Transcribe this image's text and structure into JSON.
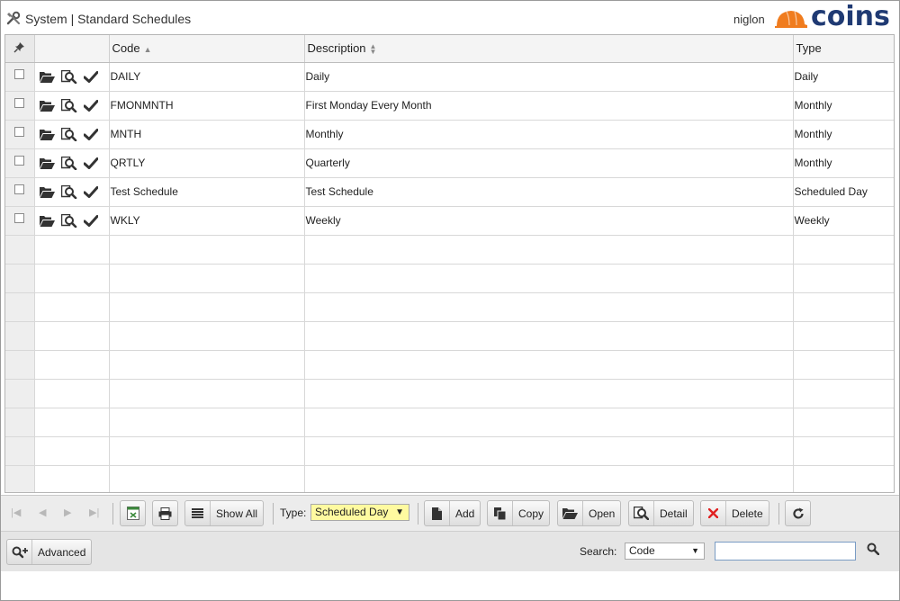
{
  "header": {
    "icon": "tools-icon",
    "title": "System | Standard Schedules",
    "user": "niglon",
    "logo_text": "COİNS",
    "logo_colors": {
      "helmet": "#f07c1e",
      "text": "#1f3a73"
    }
  },
  "grid": {
    "columns": {
      "pin": "",
      "actions": "",
      "code": "Code",
      "description": "Description",
      "type": "Type"
    },
    "rows": [
      {
        "code": "DAILY",
        "description": "Daily",
        "type": "Daily"
      },
      {
        "code": "FMONMNTH",
        "description": "First Monday Every Month",
        "type": "Monthly"
      },
      {
        "code": "MNTH",
        "description": "Monthly",
        "type": "Monthly"
      },
      {
        "code": "QRTLY",
        "description": "Quarterly",
        "type": "Monthly"
      },
      {
        "code": "Test Schedule",
        "description": "Test Schedule",
        "type": "Scheduled Day"
      },
      {
        "code": "WKLY",
        "description": "Weekly",
        "type": "Weekly"
      }
    ],
    "empty_rows": 9
  },
  "toolbar": {
    "show_all": "Show All",
    "type_label": "Type:",
    "type_value": "Scheduled Day",
    "add": "Add",
    "copy": "Copy",
    "open": "Open",
    "detail": "Detail",
    "delete": "Delete"
  },
  "footer": {
    "advanced": "Advanced",
    "search_label": "Search:",
    "search_field": "Code",
    "search_value": ""
  }
}
